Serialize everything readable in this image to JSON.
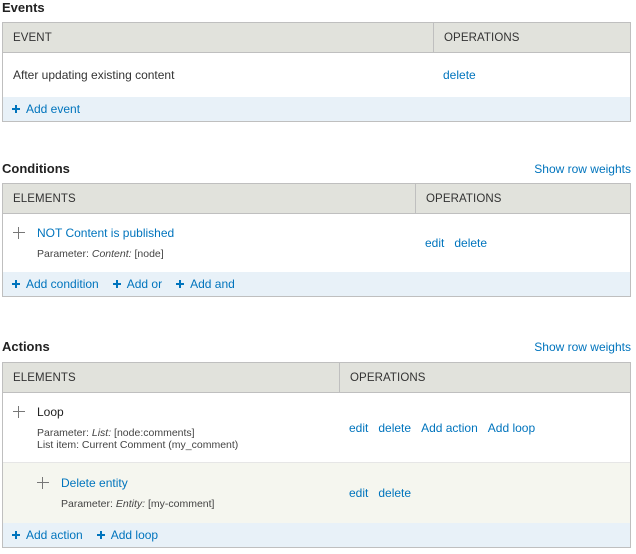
{
  "events": {
    "title": "Events",
    "col_event": "EVENT",
    "col_operations": "OPERATIONS",
    "row": {
      "label": "After updating existing content",
      "delete": "delete"
    },
    "add_event": "Add event"
  },
  "conditions": {
    "title": "Conditions",
    "row_weights": "Show row weights",
    "col_elements": "ELEMENTS",
    "col_operations": "OPERATIONS",
    "row": {
      "label": "NOT Content is published",
      "param_prefix": "Parameter:",
      "param_name": "Content:",
      "param_value": "[node]",
      "edit": "edit",
      "delete": "delete"
    },
    "add_condition": "Add condition",
    "add_or": "Add or",
    "add_and": "Add and"
  },
  "actions": {
    "title": "Actions",
    "row_weights": "Show row weights",
    "col_elements": "ELEMENTS",
    "col_operations": "OPERATIONS",
    "loop": {
      "label": "Loop",
      "param_prefix": "Parameter:",
      "param_name": "List:",
      "param_value": "[node:comments]",
      "list_item": "List item: Current Comment (my_comment)",
      "edit": "edit",
      "delete": "delete",
      "add_action": "Add action",
      "add_loop": "Add loop"
    },
    "delete_entity": {
      "label": "Delete entity",
      "param_prefix": "Parameter:",
      "param_name": "Entity:",
      "param_value": "[my-comment]",
      "edit": "edit",
      "delete": "delete"
    },
    "add_action": "Add action",
    "add_loop": "Add loop"
  }
}
